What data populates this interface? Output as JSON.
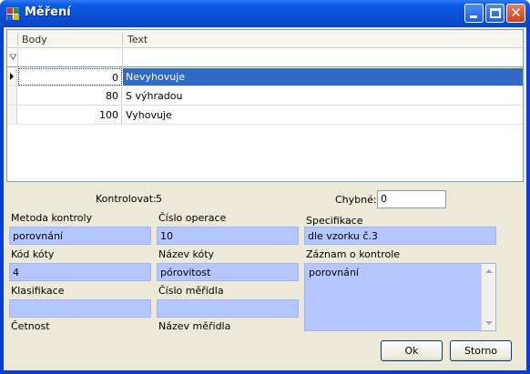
{
  "window": {
    "title": "Měření"
  },
  "grid": {
    "columns": [
      "Body",
      "Text"
    ],
    "rows": [
      {
        "body": "0",
        "text": "Nevyhovuje"
      },
      {
        "body": "80",
        "text": "S výhradou"
      },
      {
        "body": "100",
        "text": "Vyhovuje"
      }
    ],
    "filter_icon": "filter-icon",
    "selected_row": 0
  },
  "form": {
    "kontrolovat_label": "Kontrolovat:",
    "kontrolovat_value": "5",
    "chybne_label": "Chybné:",
    "chybne_value": "0",
    "metoda_label": "Metoda kontroly",
    "metoda_value": "porovnání",
    "cislo_operace_label": "Číslo operace",
    "cislo_operace_value": "10",
    "specifikace_label": "Specifikace",
    "specifikace_value": "dle vzorku č.3",
    "kod_koty_label": "Kód kóty",
    "kod_koty_value": "4",
    "nazev_koty_label": "Název kóty",
    "nazev_koty_value": "pórovitost",
    "zaznam_label": "Záznam o kontrole",
    "zaznam_value": "porovnání",
    "klasifikace_label": "Klasifikace",
    "klasifikace_value": "",
    "cislo_meridla_label": "Číslo měřidla",
    "cislo_meridla_value": "",
    "cetnost_label": "Četnost",
    "nazev_meridla_label": "Název měřidla"
  },
  "buttons": {
    "ok": "Ok",
    "cancel": "Storno"
  },
  "colors": {
    "titlebar": "#0a58e8",
    "field": "#b3c6ff",
    "selection": "#3169c6",
    "dialog_bg": "#ece9d8"
  }
}
